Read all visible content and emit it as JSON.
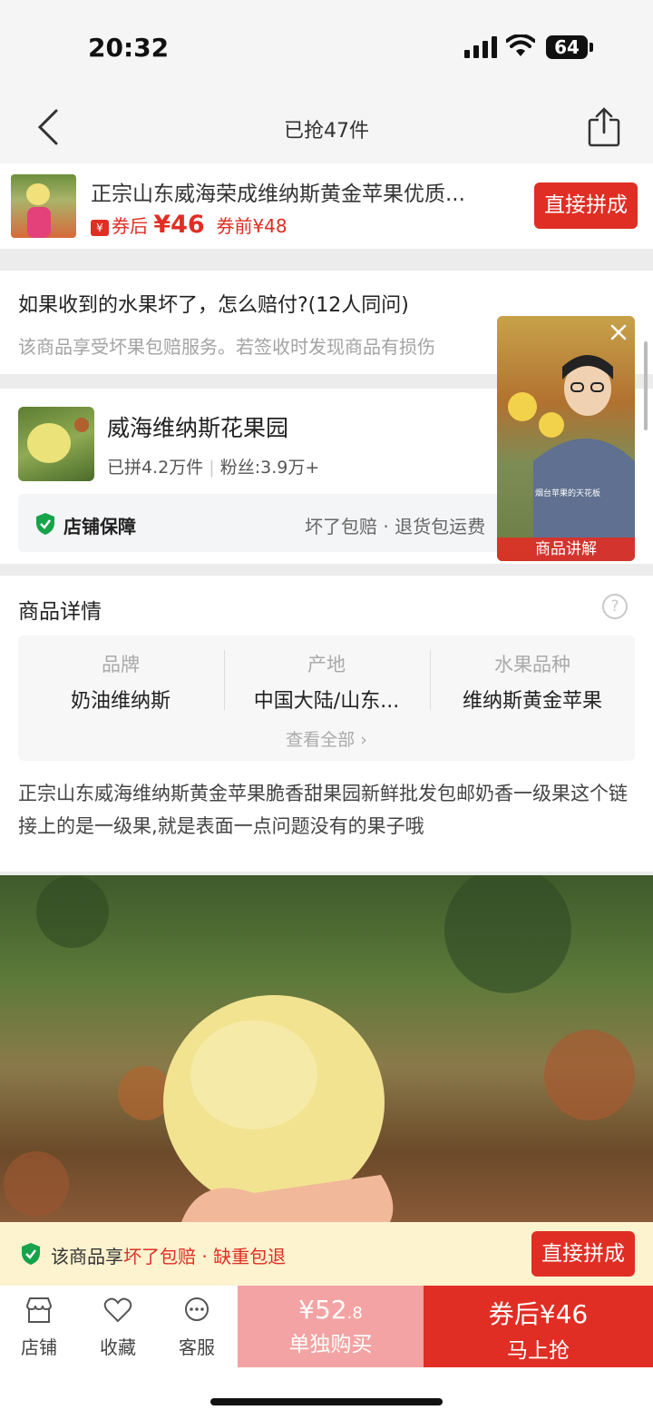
{
  "status_bar": {
    "time": "20:32",
    "battery": "64"
  },
  "nav": {
    "title": "已抢47件"
  },
  "sticky_product": {
    "title": "正宗山东威海荣成维纳斯黄金苹果优质...",
    "coupon_icon": "¥",
    "after_coupon_label": "券后",
    "after_coupon_price": "¥46",
    "before_coupon": "券前¥48",
    "button": "直接拼成"
  },
  "qa": {
    "question": "如果收到的水果坏了，怎么赔付?(12人同问)",
    "answer": "该商品享受坏果包赔服务。若签收时发现商品有损伤"
  },
  "shop": {
    "name": "威海维纳斯花果园",
    "sold": "已拼4.2万件",
    "fans": "粉丝:3.9万+",
    "guarantee_label": "店铺保障",
    "guarantee_items": "坏了包赔 · 退货包运费"
  },
  "video": {
    "label": "商品讲解",
    "caption": "烟台苹果的天花板"
  },
  "detail": {
    "title": "商品详情",
    "help": "?",
    "attributes": [
      {
        "key": "品牌",
        "value": "奶油维纳斯"
      },
      {
        "key": "产地",
        "value": "中国大陆/山东..."
      },
      {
        "key": "水果品种",
        "value": "维纳斯黄金苹果"
      }
    ],
    "view_all": "查看全部",
    "description": "正宗山东威海维纳斯黄金苹果脆香甜果园新鲜批发包邮奶香一级果这个链接上的是一级果,就是表面一点问题没有的果子哦"
  },
  "notice": {
    "prefix": "该商品享",
    "highlight": "坏了包赔 · 缺重包退",
    "button": "直接拼成"
  },
  "bottom_bar": {
    "tabs": [
      {
        "label": "店铺",
        "icon": "store-icon"
      },
      {
        "label": "收藏",
        "icon": "heart-icon"
      },
      {
        "label": "客服",
        "icon": "chat-icon"
      }
    ],
    "buy_alone_price": "¥52",
    "buy_alone_cents": ".8",
    "buy_alone_label": "单独购买",
    "buy_now_price": "券后¥46",
    "buy_now_label": "马上抢"
  },
  "colors": {
    "accent": "#e02e24",
    "notice_bg": "#fdf3cf",
    "guarantee_green": "#16a34a"
  }
}
